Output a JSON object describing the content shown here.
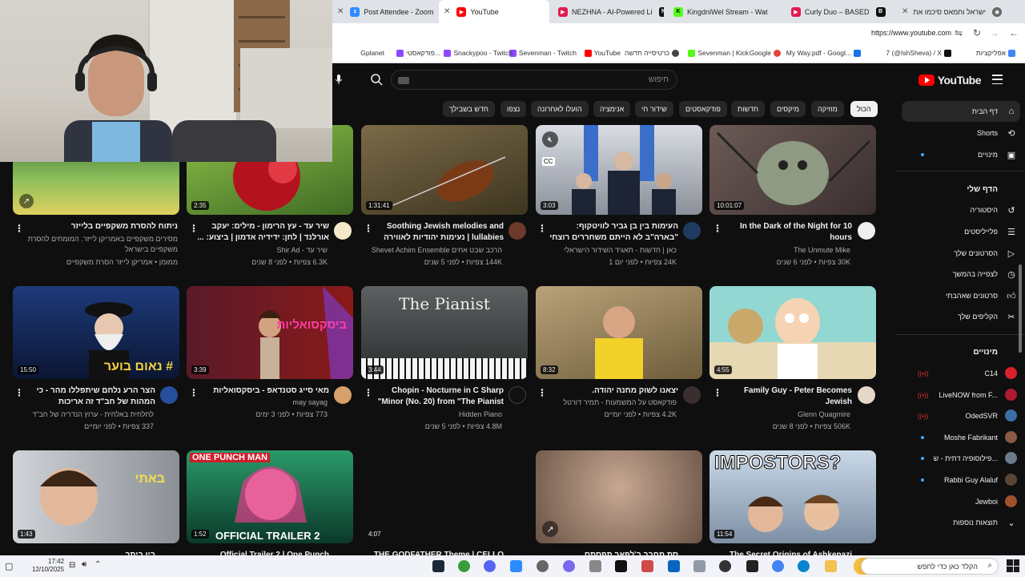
{
  "browser": {
    "tabs": [
      {
        "label": "Post Attendee - Zoom",
        "icon": "zoom-icon",
        "color": "#2d8cff",
        "active": false
      },
      {
        "label": "YouTube",
        "icon": "youtube-icon",
        "color": "#ff0000",
        "active": true
      },
      {
        "label": "NEZHNA - AI-Powered Li",
        "icon": "n-icon",
        "color": "#111111",
        "active": false
      },
      {
        "label": "KingdniWel Stream - Wat",
        "icon": "kick-icon",
        "color": "#53fc18",
        "active": false
      },
      {
        "label": "Curly Duo – BASED",
        "icon": "b-icon",
        "color": "#111111",
        "active": false
      },
      {
        "label": "ישראל וחמאס סיכמו את",
        "icon": "news-icon",
        "color": "#444444",
        "active": false
      }
    ],
    "url": "https://www.youtube.com",
    "bookmarks": [
      {
        "label": "אפליקציות"
      },
      {
        "label": "7 (@IshSheva) / X"
      },
      {
        "label": "My Way.pdf - Googl..."
      },
      {
        "label": "Google"
      },
      {
        "label": "Sevenman | Kick"
      },
      {
        "label": "כרטיסייה חדשה"
      },
      {
        "label": "YouTube"
      },
      {
        "label": "Sevenman - Twitch"
      },
      {
        "label": "Snackypoo - Twitch"
      },
      {
        "label": "פודקאסטי..."
      },
      {
        "label": "Gplanet"
      }
    ]
  },
  "header": {
    "logo": "YouTube",
    "search_placeholder": "חיפוש"
  },
  "chips": [
    "הכול",
    "מוזיקה",
    "מיקסים",
    "חדשות",
    "פודקאסטים",
    "שידור חי",
    "אנימציה",
    "הועלו לאחרונה",
    "נצפו",
    "חדש בשבילך"
  ],
  "sidebar": {
    "main": [
      {
        "label": "דף הבית",
        "icon": "home-icon"
      },
      {
        "label": "Shorts",
        "icon": "shorts-icon"
      },
      {
        "label": "מינויים",
        "icon": "subscriptions-icon"
      }
    ],
    "you_title": "הדף שלי",
    "you": [
      {
        "label": "היסטוריה",
        "icon": "history-icon"
      },
      {
        "label": "פלייליסטים",
        "icon": "playlists-icon"
      },
      {
        "label": "הסרטונים שלך",
        "icon": "your-videos-icon"
      },
      {
        "label": "לצפייה בהמשך",
        "icon": "watch-later-icon"
      },
      {
        "label": "סרטונים שאהבתי",
        "icon": "liked-icon"
      },
      {
        "label": "הקליפים שלך",
        "icon": "clips-icon"
      }
    ],
    "subs_title": "מינויים",
    "subs": [
      {
        "label": "C14",
        "color": "#d9212b"
      },
      {
        "label": "LiveNOW from F...",
        "color": "#b01c2e"
      },
      {
        "label": "OdedSVR",
        "color": "#3b6ea5"
      },
      {
        "label": "Moshe Fabrikant",
        "color": "#8a5a44"
      },
      {
        "label": "פילוסופיה דתית - ש...",
        "color": "#6b7b8c"
      },
      {
        "label": "Rabbi Guy Alaluf",
        "color": "#5a4636"
      },
      {
        "label": "Jewboi",
        "color": "#a0522d"
      },
      {
        "label": "תוצאות נוספות",
        "color": "#272727"
      }
    ]
  },
  "videos": [
    {
      "title": "In the Dark of the Night for 10 hours",
      "channel": "The Unmute Mike",
      "meta": "30K צפיות • לפני 6 שנים",
      "duration": "10:01:07"
    },
    {
      "title": "העימות בין בן גביר לוויטקוף: \"בארה\"ב לא הייתם משחררים רוצחי תינוקות\"",
      "channel": "כאן | חדשות - תאגיד השידור הישראלי",
      "meta": "24K צפיות • לפני יום 1",
      "duration": "3:03"
    },
    {
      "title": "Soothing Jewish melodies and lullabies | נעימות יהודיות לאווירה",
      "channel": "הרכב שבט אחים Shevet Achim Ensemble",
      "meta": "144K צפיות • לפני 5 שנים",
      "duration": "1:31:41"
    },
    {
      "title": "שיר עד - עץ הרימון - מילים: יעקב אורלנד | לחן: ידידיה אדמון | ביצוע: ...",
      "channel": "שיר עד - Shir Ad",
      "meta": "6.3K צפיות • לפני 8 שנים",
      "duration": "2:35"
    },
    {
      "title": "ניתוח להסרת משקפיים בלייזר",
      "channel": "מסירים משקפיים באמריקן לייזר. המומחים להסרת משקפיים בישראל",
      "meta": "ממומן • אמריקן לייזר הסרת משקפיים",
      "duration": ""
    },
    {
      "title": "Family Guy - Peter Becomes Jewish",
      "channel": "Glenn Quagmire",
      "meta": "506K צפיות • לפני 8 שנים",
      "duration": "4:55"
    },
    {
      "title": "יצאנו לשוק מחנה יהודה.",
      "channel": "פודקאסט על המשמעות - תמיר דורטל",
      "meta": "4.2K צפיות • לפני יומיים",
      "duration": "8:32"
    },
    {
      "title": "Chopin - Nocturne in C Sharp Minor (No. 20) from \"The Pianist\"",
      "channel": "Hidden Piano",
      "meta": "4.8M צפיות • לפני 5 שנים",
      "duration": "3:44"
    },
    {
      "title": "מאי סייג סטנדאפ - ביסקסואליות",
      "channel": "may sayag",
      "meta": "773 צפיות • לפני 3 ימים",
      "duration": "3:39"
    },
    {
      "title": "הצר הרע נלחם שיתפללו מהר - כי המהות של חב\"ד זה אריכות התפילה!...",
      "channel": "לחלחית באלחית - ערוץ הנדריה של חב\"ד",
      "meta": "337 צפיות • לפני יומיים",
      "duration": "15:50"
    },
    {
      "title": "The Secret Origins of Ashkenazi",
      "channel": "",
      "meta": "",
      "duration": "11:54"
    },
    {
      "title": "סת מחבר ב'לפאר תפסתם",
      "channel": "",
      "meta": "",
      "duration": ""
    },
    {
      "title": "THE GODFATHER Theme | CELLO",
      "channel": "",
      "meta": "",
      "duration": "4:07"
    },
    {
      "title": "Official Trailer 2 | One Punch",
      "channel": "",
      "meta": "",
      "duration": "1:52"
    },
    {
      "title": "בין ביתר",
      "channel": "",
      "meta": "",
      "duration": "1:43"
    }
  ],
  "thumb_text": {
    "pianist": "The Pianist",
    "opm": "ONE PUNCH MAN",
    "opm_trailer": "OFFICIAL TRAILER 2",
    "impostors": "IMPOSTORS?",
    "naom": "# נאום בוער",
    "bisex": "ביסקסואליות"
  },
  "taskbar": {
    "time": "17:42",
    "date": "12/10/2025",
    "search_text": "הקלד כאן כדי לחפש"
  }
}
